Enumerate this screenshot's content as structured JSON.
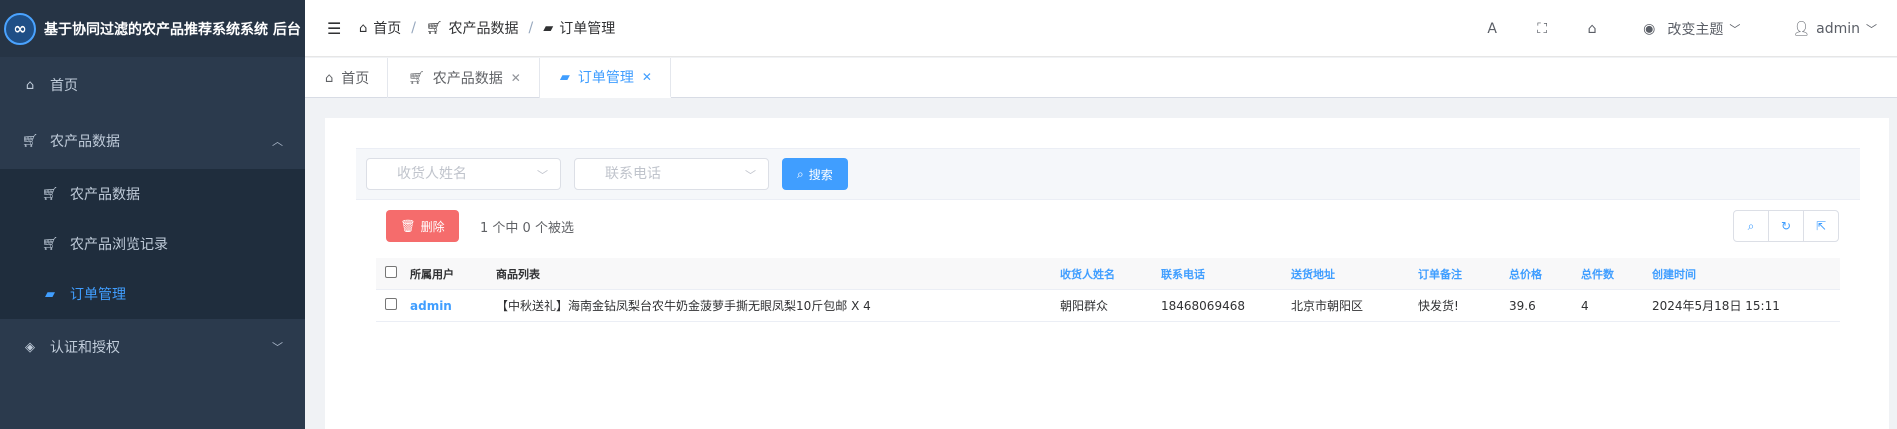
{
  "app": {
    "title": "基于协同过滤的农产品推荐系统系统 后台"
  },
  "sidebar": {
    "items": [
      {
        "label": "首页"
      },
      {
        "label": "农产品数据",
        "children": [
          {
            "label": "农产品数据"
          },
          {
            "label": "农产品浏览记录"
          },
          {
            "label": "订单管理"
          }
        ]
      },
      {
        "label": "认证和授权"
      }
    ]
  },
  "header": {
    "breadcrumb": [
      "首页",
      "农产品数据",
      "订单管理"
    ],
    "theme_label": "改变主题",
    "user_label": "admin"
  },
  "tabs": [
    {
      "label": "首页"
    },
    {
      "label": "农产品数据"
    },
    {
      "label": "订单管理"
    }
  ],
  "search": {
    "consignee_placeholder": "收货人姓名",
    "phone_placeholder": "联系电话",
    "search_label": "搜索"
  },
  "toolbar": {
    "delete_label": "删除",
    "selection_info": "1 个中 0 个被选"
  },
  "table": {
    "columns": [
      "所属用户",
      "商品列表",
      "收货人姓名",
      "联系电话",
      "送货地址",
      "订单备注",
      "总价格",
      "总件数",
      "创建时间"
    ],
    "rows": [
      {
        "user": "admin",
        "products": "【中秋送礼】海南金钻凤梨台农牛奶金菠萝手撕无眼凤梨10斤包邮 X 4",
        "consignee": "朝阳群众",
        "phone": "18468069468",
        "address": "北京市朝阳区",
        "note": "快发货!",
        "total_price": "39.6",
        "total_count": "4",
        "created": "2024年5月18日 15:11"
      }
    ]
  },
  "colors": {
    "primary": "#409eff",
    "danger": "#f56c6c",
    "sidebar": "#2b3a4d"
  }
}
